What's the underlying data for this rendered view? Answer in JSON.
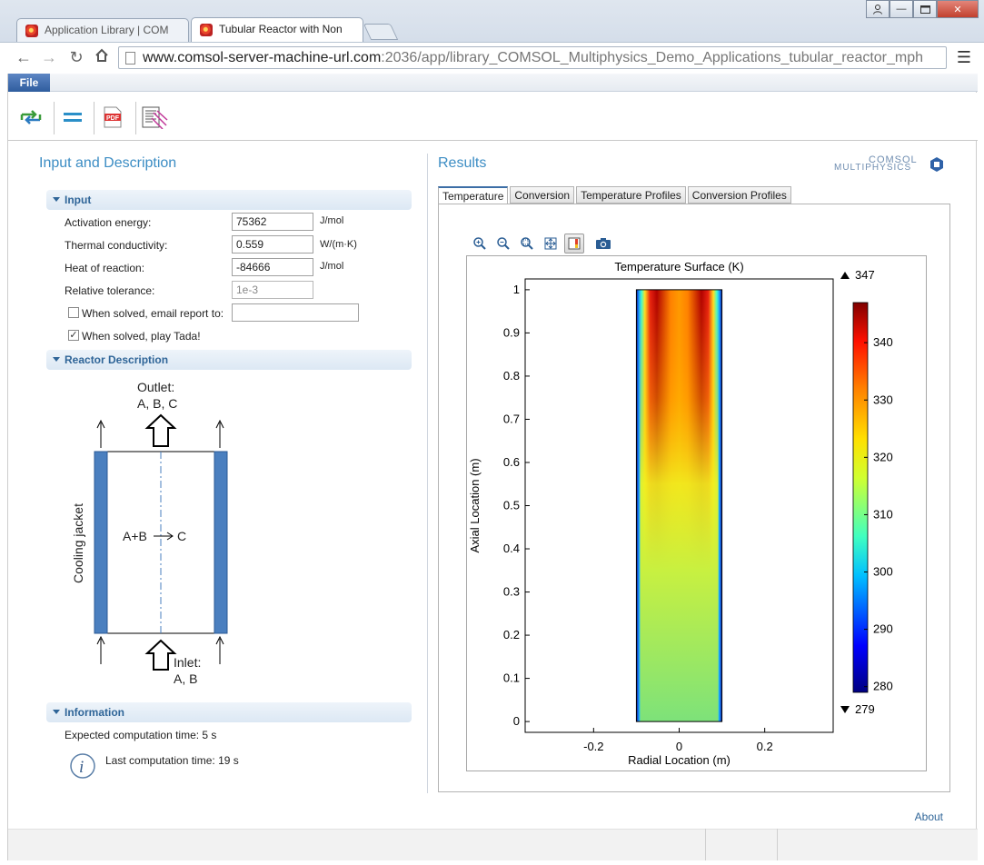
{
  "browser": {
    "tabs": [
      {
        "label": "Application Library | COM"
      },
      {
        "label": "Tubular Reactor with Non"
      }
    ],
    "url_host": "www.comsol-server-machine-url.com",
    "url_path": ":2036/app/library_COMSOL_Multiphysics_Demo_Applications_tubular_reactor_mph"
  },
  "app": {
    "file_menu": "File",
    "left_title": "Input and Description",
    "right_title": "Results",
    "input": {
      "header": "Input",
      "activation_energy_label": "Activation energy:",
      "activation_energy_value": "75362",
      "activation_energy_unit": "J/mol",
      "thermal_conductivity_label": "Thermal conductivity:",
      "thermal_conductivity_value": "0.559",
      "thermal_conductivity_unit": "W/(m·K)",
      "heat_of_reaction_label": "Heat of reaction:",
      "heat_of_reaction_value": "-84666",
      "heat_of_reaction_unit": "J/mol",
      "relative_tolerance_label": "Relative tolerance:",
      "relative_tolerance_value": "1e-3",
      "email_label": "When solved, email report to:",
      "email_value": "",
      "tada_label": "When solved, play Tada!",
      "tada_checked": true,
      "email_checked": false
    },
    "reactor": {
      "header": "Reactor Description",
      "outlet_label": "Outlet:",
      "outlet_species": "A, B, C",
      "inlet_label": "Inlet:",
      "inlet_species": "A, B",
      "reaction": "A+B",
      "product": "C",
      "jacket_label": "Cooling jacket"
    },
    "information": {
      "header": "Information",
      "expected_label": "Expected computation time:",
      "expected_value": "5 s",
      "last_label": "Last computation time:",
      "last_value": "19 s"
    },
    "results_tabs": [
      "Temperature",
      "Conversion",
      "Temperature Profiles",
      "Conversion Profiles"
    ],
    "about": "About",
    "logo_line1": "COMSOL",
    "logo_line2": "MULTIPHYSICS"
  },
  "chart_data": {
    "type": "heatmap",
    "title": "Temperature Surface (K)",
    "xlabel": "Radial Location (m)",
    "ylabel": "Axial Location (m)",
    "xlim": [
      -0.36,
      0.36
    ],
    "ylim": [
      -0.025,
      1.025
    ],
    "xticks": [
      -0.2,
      0,
      0.2
    ],
    "yticks": [
      0,
      0.1,
      0.2,
      0.3,
      0.4,
      0.5,
      0.6,
      0.7,
      0.8,
      0.9,
      1
    ],
    "domain_x": [
      -0.1,
      0.1
    ],
    "domain_y": [
      0,
      1
    ],
    "colorbar": {
      "min_marker": "279",
      "max_marker": "347",
      "range": [
        279,
        347
      ],
      "ticks": [
        280,
        290,
        300,
        310,
        320,
        330,
        340
      ]
    },
    "grid": false
  }
}
